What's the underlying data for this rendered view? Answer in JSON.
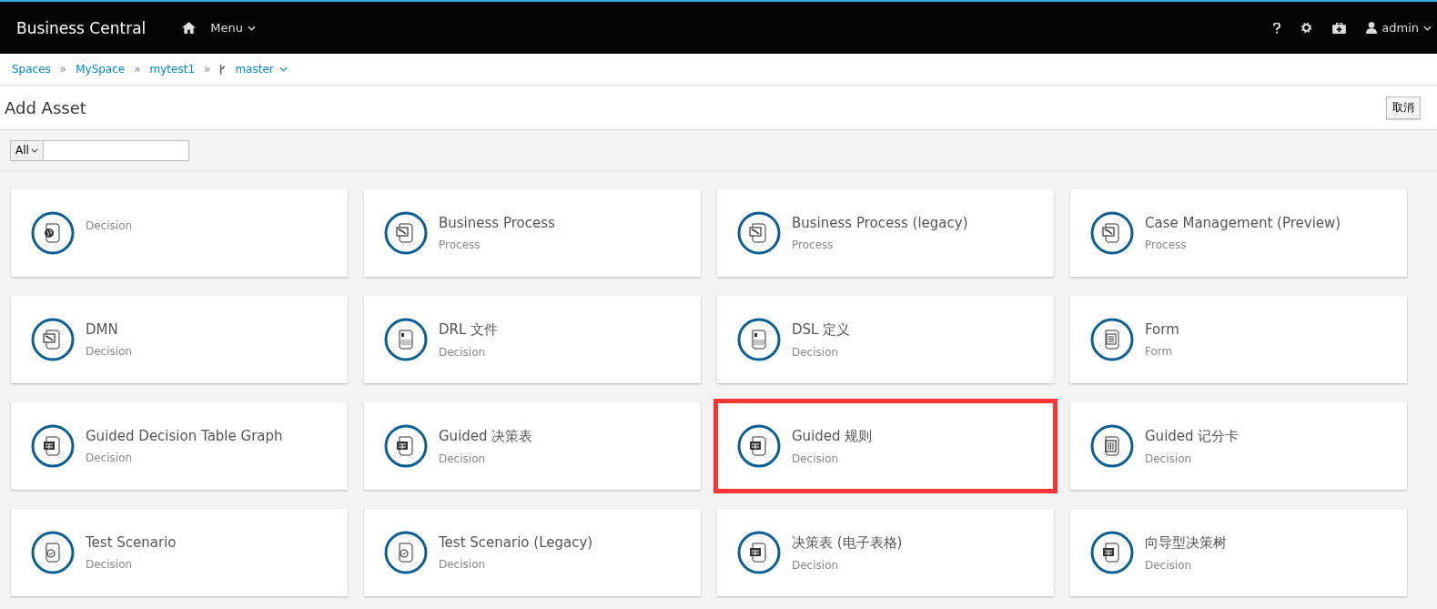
{
  "navbar": {
    "brand": "Business Central",
    "menu": "Menu",
    "user": "admin"
  },
  "breadcrumbs": [
    {
      "label": "Spaces",
      "separator": "»"
    },
    {
      "label": "MySpace",
      "separator": "»"
    },
    {
      "label": "mytest1",
      "separator": "»"
    }
  ],
  "branch": "master",
  "page": {
    "title": "Add Asset",
    "cancel": "取消"
  },
  "filter": {
    "scope": "All"
  },
  "assets": [
    {
      "category": "Decision",
      "kind": "globe",
      "highlighted": false
    },
    {
      "title": "Business Process",
      "category": "Process",
      "kind": "process",
      "highlighted": false
    },
    {
      "title": "Business Process (legacy)",
      "category": "Process",
      "kind": "process",
      "highlighted": false
    },
    {
      "title": "Case Management (Preview)",
      "category": "Process",
      "kind": "process",
      "highlighted": false
    },
    {
      "title": "DMN",
      "category": "Decision",
      "kind": "process",
      "highlighted": false
    },
    {
      "title": "DRL 文件",
      "category": "Decision",
      "kind": "rule",
      "highlighted": false
    },
    {
      "title": "DSL 定义",
      "category": "Decision",
      "kind": "rule",
      "highlighted": false
    },
    {
      "title": "Form",
      "category": "Form",
      "kind": "form",
      "highlighted": false
    },
    {
      "title": "Guided Decision Table Graph",
      "category": "Decision",
      "kind": "table",
      "highlighted": false
    },
    {
      "title": "Guided 决策表",
      "category": "Decision",
      "kind": "table",
      "highlighted": false
    },
    {
      "title": "Guided 规则",
      "category": "Decision",
      "kind": "table",
      "highlighted": true
    },
    {
      "title": "Guided 记分卡",
      "category": "Decision",
      "kind": "score",
      "highlighted": false
    },
    {
      "title": "Test Scenario",
      "category": "Decision",
      "kind": "check",
      "highlighted": false
    },
    {
      "title": "Test Scenario (Legacy)",
      "category": "Decision",
      "kind": "check",
      "highlighted": false
    },
    {
      "title": "决策表 (电子表格)",
      "category": "Decision",
      "kind": "table",
      "highlighted": false
    },
    {
      "title": "向导型决策树",
      "category": "Decision",
      "kind": "table",
      "highlighted": false
    }
  ]
}
